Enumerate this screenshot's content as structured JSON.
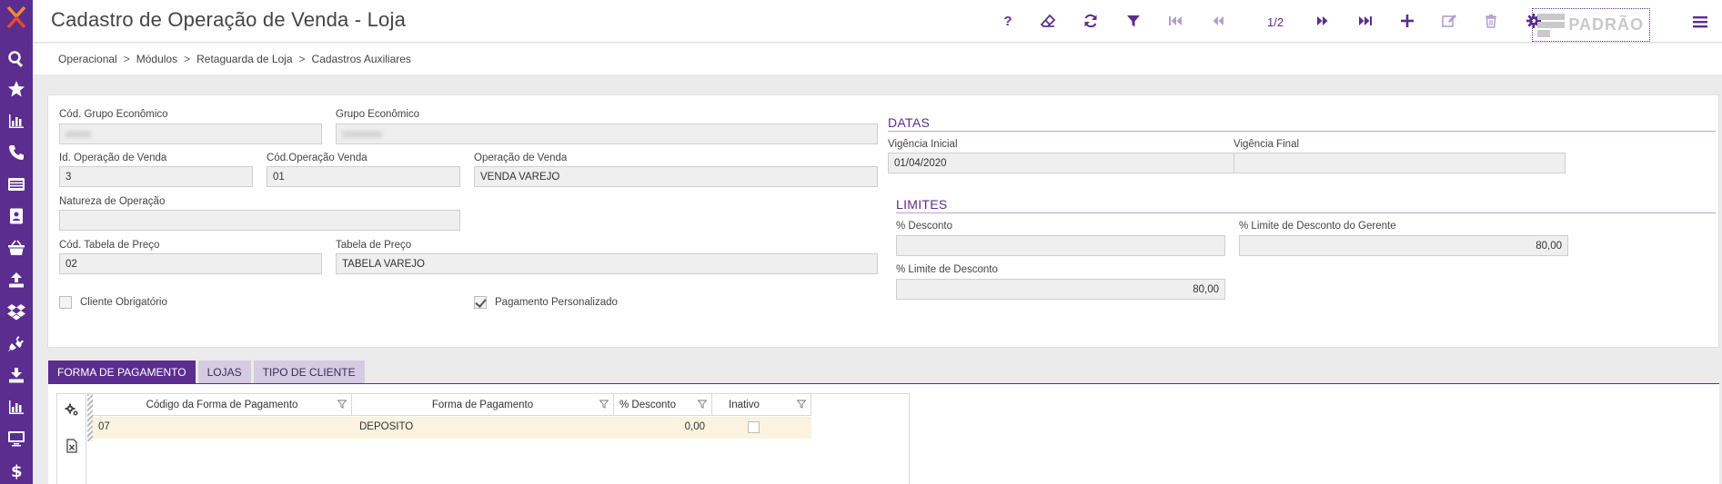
{
  "app": {
    "title": "Cadastro de Operação de Venda - Loja"
  },
  "sidebar": {
    "icons": [
      "logo-icon",
      "search-icon",
      "star-icon",
      "bar-chart-icon",
      "phone-icon",
      "list-icon",
      "contact-card-icon",
      "basket-icon",
      "upload-icon",
      "dropbox-icon",
      "plug-icon",
      "download-icon",
      "bar-chart-icon",
      "monitor-icon",
      "dollar-icon"
    ]
  },
  "toolbar": {
    "help_label": "?",
    "pager": "1/2",
    "padrao_label": "PADRÃO",
    "icons": [
      "help-icon",
      "eraser-icon",
      "refresh-icon",
      "filter-icon",
      "first-record-icon",
      "previous-record-icon",
      "next-record-icon",
      "last-record-icon",
      "add-icon",
      "edit-icon",
      "delete-icon",
      "settings-icon",
      "hamburger-menu-icon"
    ]
  },
  "breadcrumb": {
    "items": [
      "Operacional",
      "Módulos",
      "Retaguarda de Loja",
      "Cadastros Auxiliares"
    ],
    "separator": ">"
  },
  "form": {
    "cod_grupo_economico": {
      "label": "Cód. Grupo Econômico",
      "value": ""
    },
    "grupo_economico": {
      "label": "Grupo Econômico",
      "value": ""
    },
    "id_operacao_venda": {
      "label": "Id. Operação de Venda",
      "value": "3"
    },
    "cod_operacao_venda": {
      "label": "Cód.Operação Venda",
      "value": "01"
    },
    "operacao_venda": {
      "label": "Operação de Venda",
      "value": "VENDA VAREJO"
    },
    "natureza_operacao": {
      "label": "Natureza de Operação",
      "value": ""
    },
    "cod_tabela_preco": {
      "label": "Cód. Tabela de Preço",
      "value": "02"
    },
    "tabela_preco": {
      "label": "Tabela de Preço",
      "value": "TABELA VAREJO"
    },
    "cliente_obrigatorio": {
      "label": "Cliente Obrigatório",
      "checked": false
    },
    "pagamento_personalizado": {
      "label": "Pagamento Personalizado",
      "checked": true
    }
  },
  "datas": {
    "title": "DATAS",
    "vigencia_inicial": {
      "label": "Vigência Inicial",
      "value": "01/04/2020"
    },
    "vigencia_final": {
      "label": "Vigência Final",
      "value": ""
    }
  },
  "limites": {
    "title": "LIMITES",
    "desconto": {
      "label": "% Desconto",
      "value": ""
    },
    "limite_gerente": {
      "label": "% Limite de Desconto do Gerente",
      "value": "80,00"
    },
    "limite_desconto": {
      "label": "% Limite de Desconto",
      "value": "80,00"
    }
  },
  "tabs": [
    {
      "label": "FORMA DE PAGAMENTO",
      "active": true
    },
    {
      "label": "LOJAS",
      "active": false
    },
    {
      "label": "TIPO DE CLIENTE",
      "active": false
    }
  ],
  "grid": {
    "columns": [
      "Código da Forma de Pagamento",
      "Forma de Pagamento",
      "% Desconto",
      "Inativo"
    ],
    "rows": [
      {
        "codigo": "07",
        "forma": "DEPOSITO",
        "desconto": "0,00",
        "inativo": false
      }
    ]
  },
  "colors": {
    "brand": "#5b2d8e",
    "tab_inactive": "#d5cbe2",
    "row_highlight": "#fbf3df",
    "field_bg": "#efefef"
  }
}
